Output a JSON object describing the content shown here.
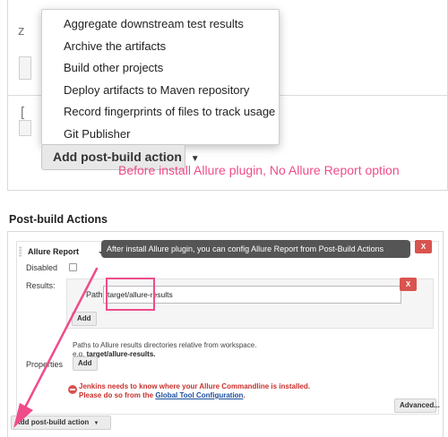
{
  "before": {
    "menu_items": [
      "Aggregate downstream test results",
      "Archive the artifacts",
      "Build other projects",
      "Deploy artifacts to Maven repository",
      "Record fingerprints of files to track usage",
      "Git Publisher"
    ],
    "add_button_label": "Add post-build action",
    "add_button_icon": "caret-down-icon",
    "annotation": "Before install Allure plugin, No Allure Report option"
  },
  "after": {
    "section_title": "Post-build Actions",
    "tooltip": "After install Allure plugin, you can config Allure Report from Post-Build Actions",
    "block_title": "Allure Report",
    "disabled_label": "Disabled",
    "results_label": "Results:",
    "path_label": "Path",
    "path_value": "target/allure-results",
    "delete_label": "X",
    "add_label": "Add",
    "hint_line1": "Paths to Allure results directories relative from workspace.",
    "hint_line2_prefix": "e.g.",
    "hint_line2_value": "target/allure-results.",
    "properties_label": "Properties",
    "properties_add_label": "Add",
    "warning_line1": "Jenkins needs to know where your Allure Commandline is installed.",
    "warning_line2_prefix": "Please do so from the",
    "warning_link": "Global Tool Configuration",
    "warning_line2_suffix": ".",
    "advanced_label": "Advanced...",
    "add_button_label": "Add post-build action",
    "warning_icon": "error-circle-icon"
  },
  "colors": {
    "annotation_pink": "#ef4c8a",
    "delete_red": "#d9534f",
    "warning_red": "#c9302c",
    "tooltip_bg": "#555555",
    "link_blue": "#1a4f9c"
  }
}
